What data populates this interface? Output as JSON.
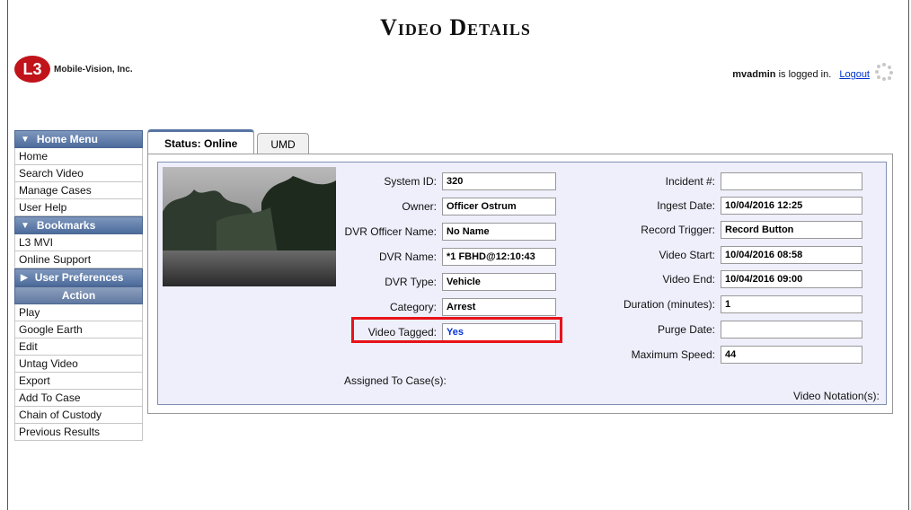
{
  "page": {
    "title": "Video Details"
  },
  "brand": {
    "logo_mark": "L3",
    "company": "Mobile-Vision, Inc.",
    "color": "#c1131a"
  },
  "session": {
    "user": "mvadmin",
    "status_text": "is logged in.",
    "logout_label": "Logout"
  },
  "sidebar": {
    "home_menu": {
      "header": "Home Menu",
      "items": [
        "Home",
        "Search Video",
        "Manage Cases",
        "User Help"
      ]
    },
    "bookmarks": {
      "header": "Bookmarks",
      "items": [
        "L3 MVI",
        "Online Support"
      ]
    },
    "user_preferences": {
      "header": "User Preferences"
    },
    "action": {
      "header": "Action",
      "items": [
        "Play",
        "Google Earth",
        "Edit",
        "Untag Video",
        "Export",
        "Add To Case",
        "Chain of Custody",
        "Previous Results"
      ]
    }
  },
  "tabs": [
    {
      "label": "Status: Online",
      "active": true
    },
    {
      "label": "UMD",
      "active": false
    }
  ],
  "details": {
    "left": [
      {
        "label": "System ID:",
        "value": "320"
      },
      {
        "label": "Owner:",
        "value": "Officer Ostrum"
      },
      {
        "label": "DVR Officer Name:",
        "value": "No Name"
      },
      {
        "label": "DVR Name:",
        "value": "*1 FBHD@12:10:43"
      },
      {
        "label": "DVR Type:",
        "value": "Vehicle"
      },
      {
        "label": "Category:",
        "value": "Arrest"
      },
      {
        "label": "Video Tagged:",
        "value": "Yes"
      }
    ],
    "right": [
      {
        "label": "Incident #:",
        "value": ""
      },
      {
        "label": "Ingest Date:",
        "value": "10/04/2016 12:25"
      },
      {
        "label": "Record Trigger:",
        "value": "Record Button"
      },
      {
        "label": "Video Start:",
        "value": "10/04/2016 08:58"
      },
      {
        "label": "Video End:",
        "value": "10/04/2016 09:00"
      },
      {
        "label": "Duration (minutes):",
        "value": "1"
      },
      {
        "label": "Purge Date:",
        "value": ""
      },
      {
        "label": "Maximum Speed:",
        "value": "44"
      }
    ],
    "assigned_label": "Assigned To Case(s):",
    "notation_label": "Video Notation(s):"
  },
  "colors": {
    "menu_header": "#4d6c9c",
    "panel_bg": "#eeeffb",
    "highlight": "#e8121a",
    "tagged_value": "#0a33d6"
  }
}
